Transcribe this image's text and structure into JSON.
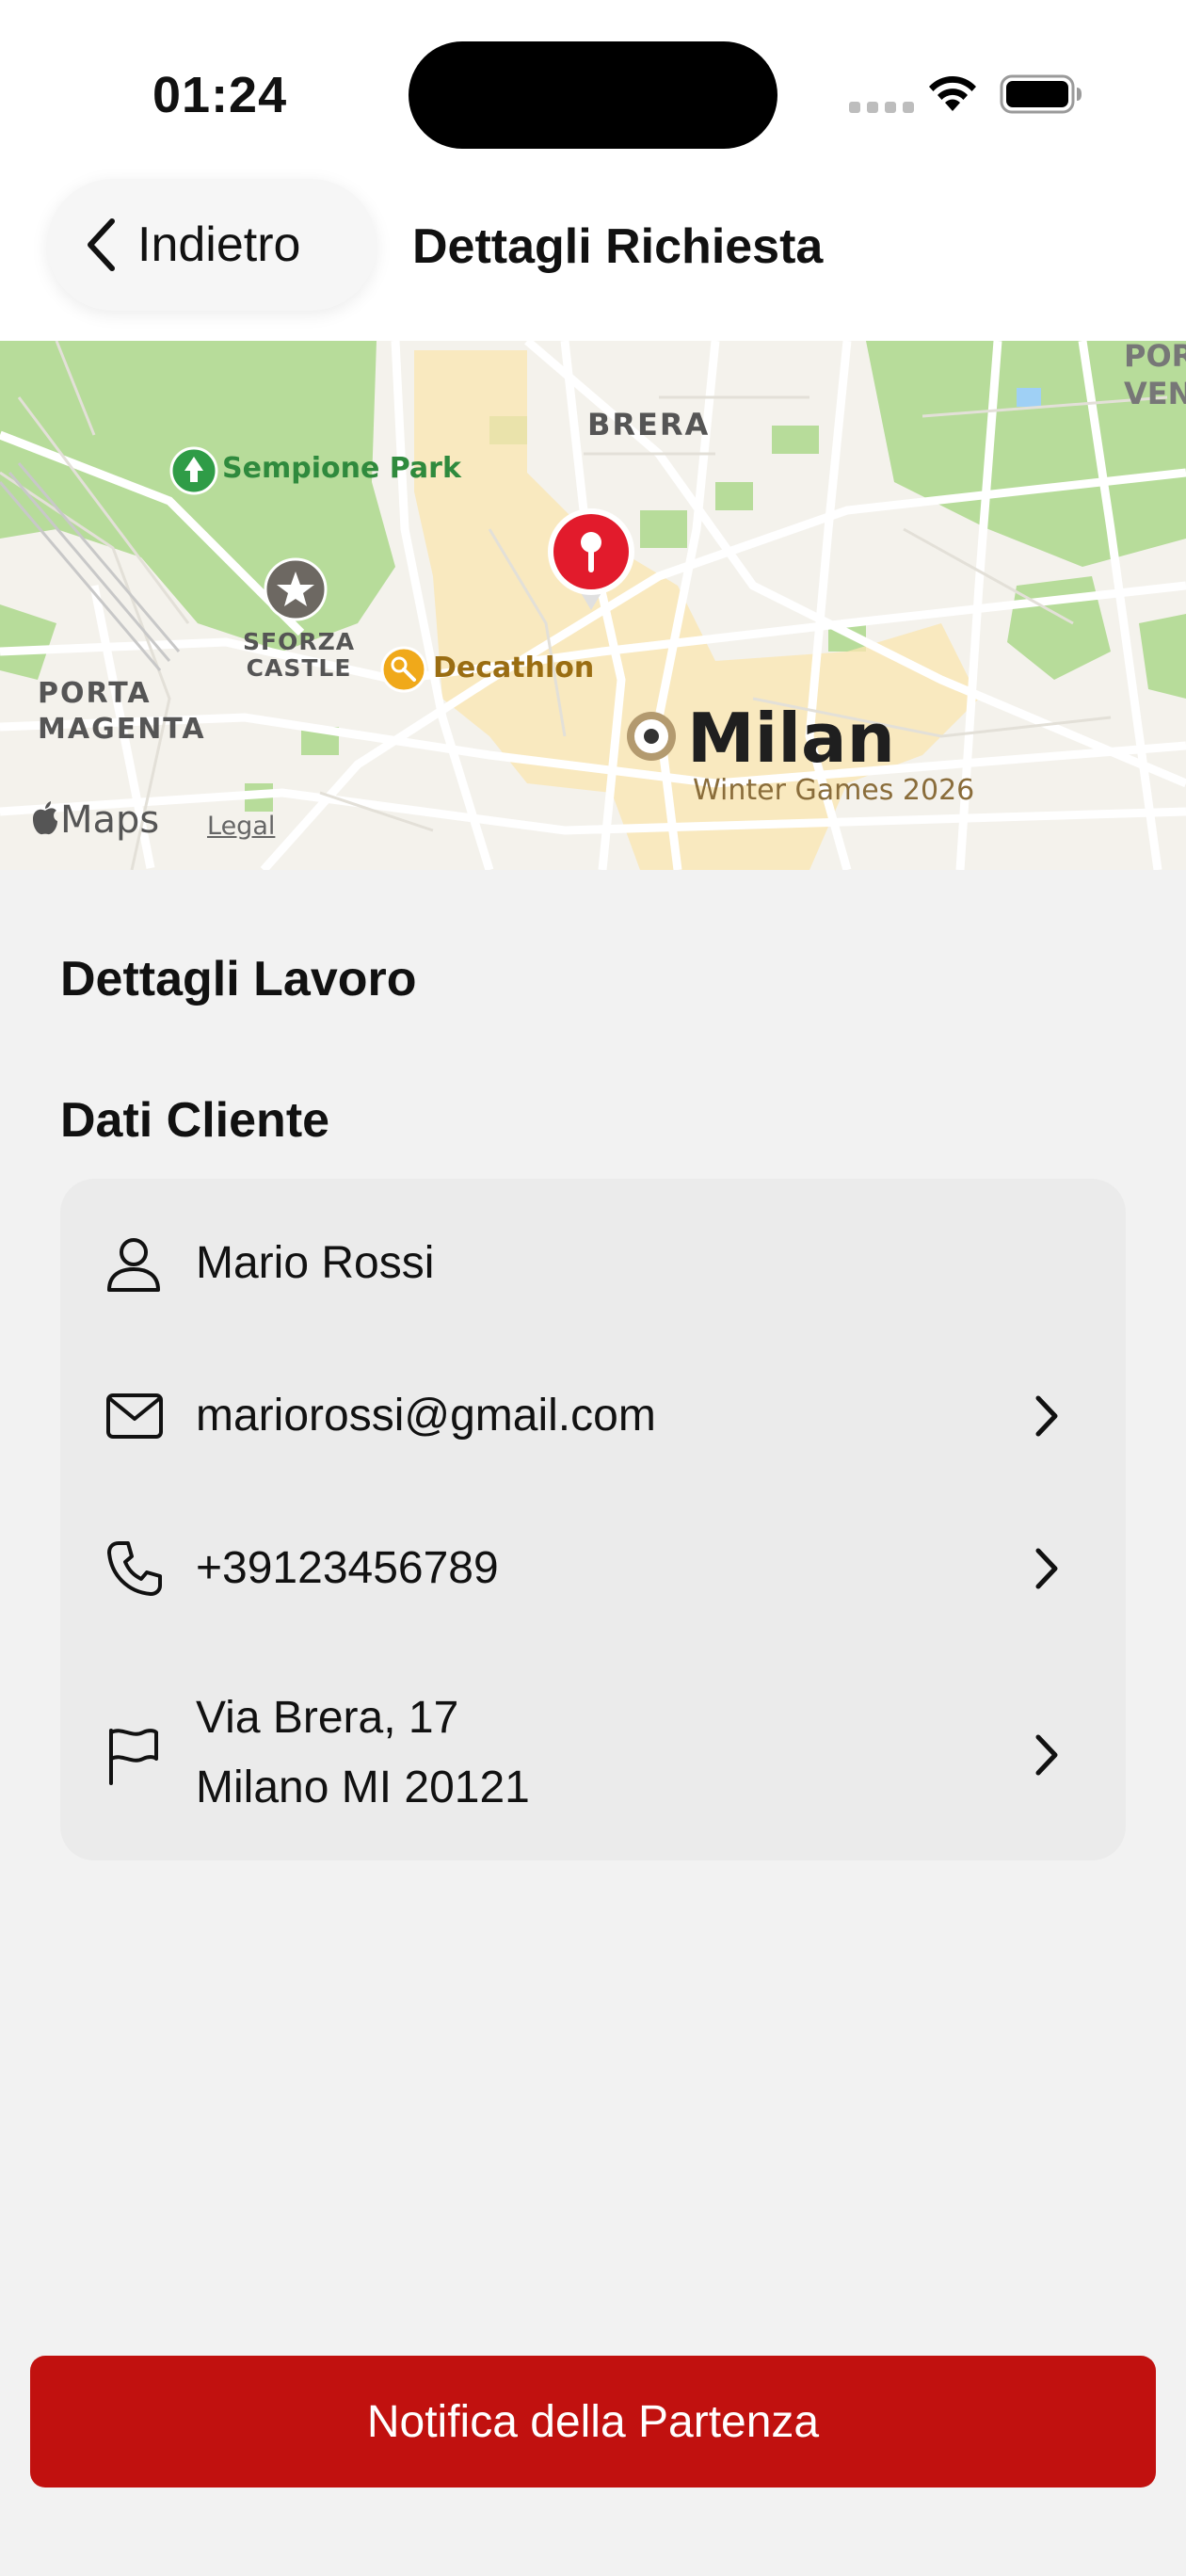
{
  "status_bar": {
    "time": "01:24"
  },
  "nav": {
    "back_label": "Indietro",
    "title": "Dettagli Richiesta"
  },
  "map": {
    "labels": {
      "brera": "BRERA",
      "sempione_park": "Sempione Park",
      "sforza_castle": "SFORZA\nCASTLE",
      "decathlon": "Decathlon",
      "porta_magenta": "PORTA\nMAGENTA",
      "milan": "Milan",
      "winter_games": "Winter Games 2026",
      "corner": "POR\nVENE",
      "maps_brand": "Maps",
      "legal": "Legal"
    },
    "icons": [
      "park-icon",
      "star-icon",
      "decathlon-icon",
      "city-dot-icon",
      "location-pin-icon",
      "apple-icon"
    ]
  },
  "sections": {
    "job_title": "Dettagli Lavoro",
    "client_title": "Dati Cliente"
  },
  "client": {
    "name": "Mario Rossi",
    "email": "mariorossi@gmail.com",
    "phone": "+39123456789",
    "address_line1": "Via Brera, 17",
    "address_line2": "Milano MI 20121"
  },
  "cta": {
    "label": "Notifica della Partenza"
  },
  "colors": {
    "accent": "#c1110f",
    "background": "#f2f2f2",
    "card": "#ebebeb"
  }
}
